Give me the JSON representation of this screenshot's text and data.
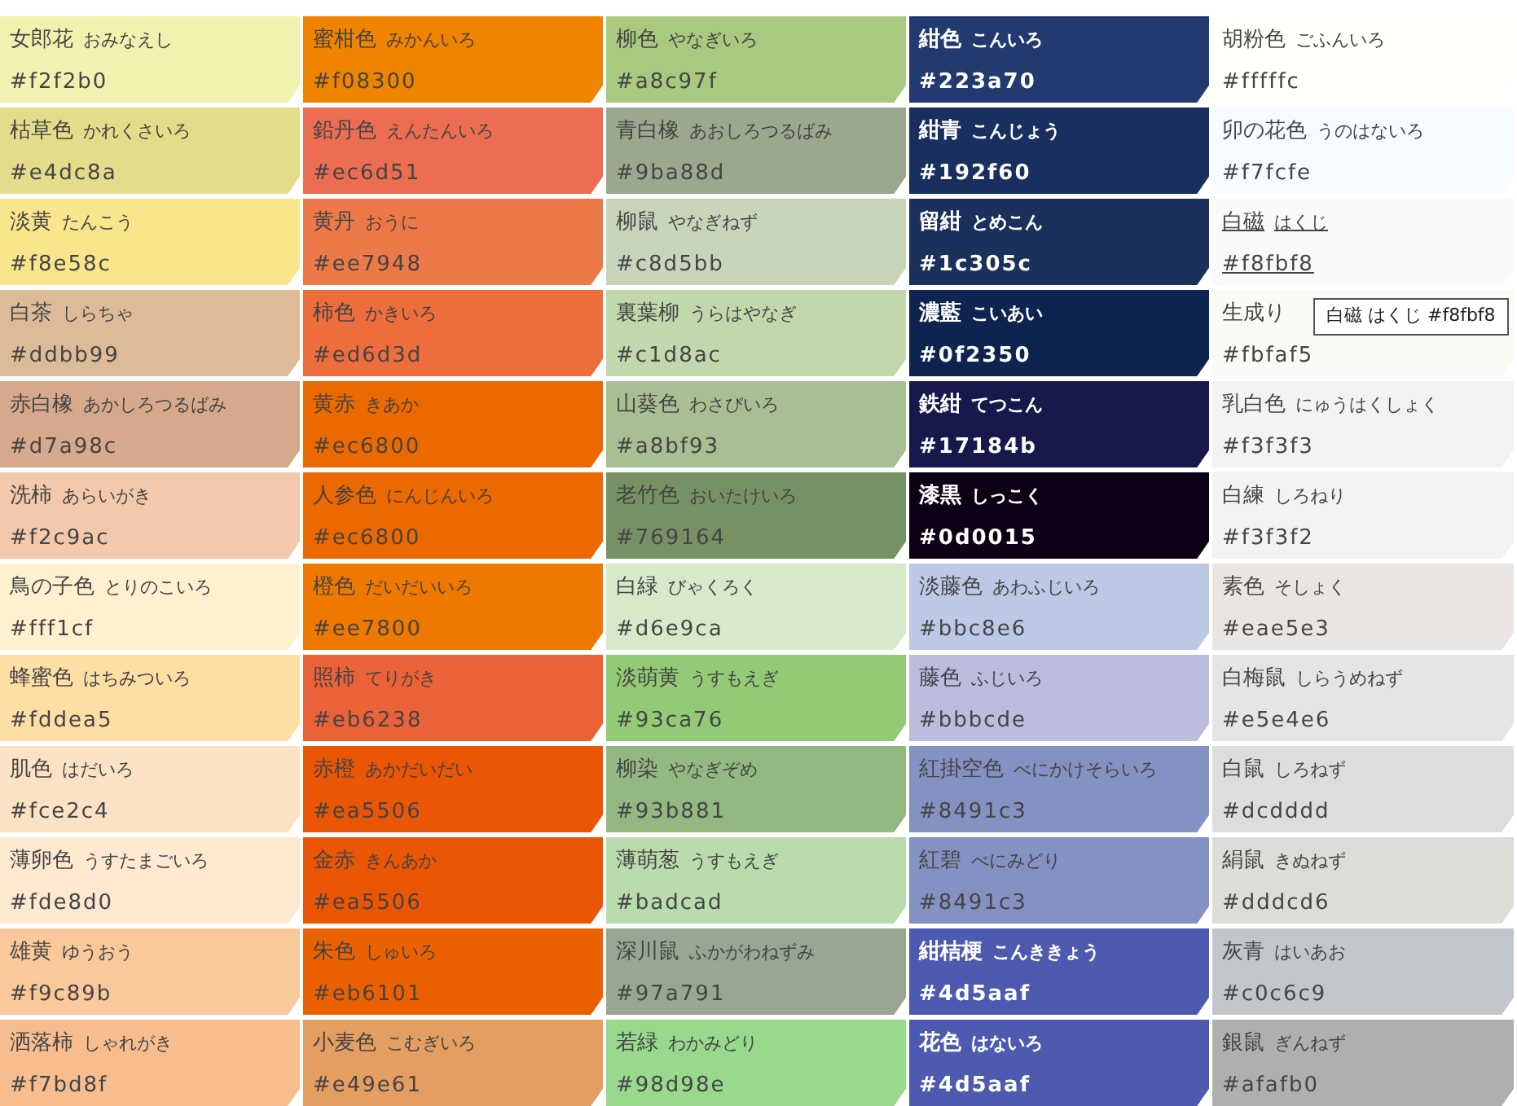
{
  "columns": [
    {
      "swatches": [
        {
          "name": "女郎花",
          "reading": "おみなえし",
          "hex": "#f2f2b0",
          "color": "#f2f2b0",
          "hovered": false
        },
        {
          "name": "枯草色",
          "reading": "かれくさいろ",
          "hex": "#e4dc8a",
          "color": "#e4dc8a",
          "hovered": false
        },
        {
          "name": "淡黄",
          "reading": "たんこう",
          "hex": "#f8e58c",
          "color": "#f8e58c",
          "hovered": false
        },
        {
          "name": "白茶",
          "reading": "しらちゃ",
          "hex": "#ddbb99",
          "color": "#ddbb99",
          "hovered": false
        },
        {
          "name": "赤白橡",
          "reading": "あかしろつるばみ",
          "hex": "#d7a98c",
          "color": "#d7a98c",
          "hovered": false
        },
        {
          "name": "洗柿",
          "reading": "あらいがき",
          "hex": "#f2c9ac",
          "color": "#f2c9ac",
          "hovered": false
        },
        {
          "name": "鳥の子色",
          "reading": "とりのこいろ",
          "hex": "#fff1cf",
          "color": "#fff1cf",
          "hovered": false
        },
        {
          "name": "蜂蜜色",
          "reading": "はちみついろ",
          "hex": "#fddea5",
          "color": "#fddea5",
          "hovered": false
        },
        {
          "name": "肌色",
          "reading": "はだいろ",
          "hex": "#fce2c4",
          "color": "#fce2c4",
          "hovered": false
        },
        {
          "name": "薄卵色",
          "reading": "うすたまごいろ",
          "hex": "#fde8d0",
          "color": "#fde8d0",
          "hovered": false
        },
        {
          "name": "雄黄",
          "reading": "ゆうおう",
          "hex": "#f9c89b",
          "color": "#f9c89b",
          "hovered": false
        },
        {
          "name": "洒落柿",
          "reading": "しゃれがき",
          "hex": "#f7bd8f",
          "color": "#f7bd8f",
          "hovered": false
        }
      ]
    },
    {
      "swatches": [
        {
          "name": "蜜柑色",
          "reading": "みかんいろ",
          "hex": "#f08300",
          "color": "#f08300",
          "hovered": false
        },
        {
          "name": "鉛丹色",
          "reading": "えんたんいろ",
          "hex": "#ec6d51",
          "color": "#ec6d51",
          "hovered": false
        },
        {
          "name": "黄丹",
          "reading": "おうに",
          "hex": "#ee7948",
          "color": "#ee7948",
          "hovered": false
        },
        {
          "name": "柿色",
          "reading": "かきいろ",
          "hex": "#ed6d3d",
          "color": "#ed6d3d",
          "hovered": false
        },
        {
          "name": "黄赤",
          "reading": "きあか",
          "hex": "#ec6800",
          "color": "#ec6800",
          "hovered": false
        },
        {
          "name": "人参色",
          "reading": "にんじんいろ",
          "hex": "#ec6800",
          "color": "#ec6800",
          "hovered": false
        },
        {
          "name": "橙色",
          "reading": "だいだいいろ",
          "hex": "#ee7800",
          "color": "#ee7800",
          "hovered": false
        },
        {
          "name": "照柿",
          "reading": "てりがき",
          "hex": "#eb6238",
          "color": "#eb6238",
          "hovered": false
        },
        {
          "name": "赤橙",
          "reading": "あかだいだい",
          "hex": "#ea5506",
          "color": "#ea5506",
          "hovered": false
        },
        {
          "name": "金赤",
          "reading": "きんあか",
          "hex": "#ea5506",
          "color": "#ea5506",
          "hovered": false
        },
        {
          "name": "朱色",
          "reading": "しゅいろ",
          "hex": "#eb6101",
          "color": "#eb6101",
          "hovered": false
        },
        {
          "name": "小麦色",
          "reading": "こむぎいろ",
          "hex": "#e49e61",
          "color": "#e49e61",
          "hovered": false
        }
      ]
    },
    {
      "swatches": [
        {
          "name": "柳色",
          "reading": "やなぎいろ",
          "hex": "#a8c97f",
          "color": "#a8c97f",
          "hovered": false
        },
        {
          "name": "青白橡",
          "reading": "あおしろつるばみ",
          "hex": "#9ba88d",
          "color": "#9ba88d",
          "hovered": false
        },
        {
          "name": "柳鼠",
          "reading": "やなぎねず",
          "hex": "#c8d5bb",
          "color": "#c8d5bb",
          "hovered": false
        },
        {
          "name": "裏葉柳",
          "reading": "うらはやなぎ",
          "hex": "#c1d8ac",
          "color": "#c1d8ac",
          "hovered": false
        },
        {
          "name": "山葵色",
          "reading": "わさびいろ",
          "hex": "#a8bf93",
          "color": "#a8bf93",
          "hovered": false
        },
        {
          "name": "老竹色",
          "reading": "おいたけいろ",
          "hex": "#769164",
          "color": "#769164",
          "hovered": false
        },
        {
          "name": "白緑",
          "reading": "びゃくろく",
          "hex": "#d6e9ca",
          "color": "#d6e9ca",
          "hovered": false
        },
        {
          "name": "淡萌黄",
          "reading": "うすもえぎ",
          "hex": "#93ca76",
          "color": "#93ca76",
          "hovered": false
        },
        {
          "name": "柳染",
          "reading": "やなぎぞめ",
          "hex": "#93b881",
          "color": "#93b881",
          "hovered": false
        },
        {
          "name": "薄萌葱",
          "reading": "うすもえぎ",
          "hex": "#badcad",
          "color": "#badcad",
          "hovered": false
        },
        {
          "name": "深川鼠",
          "reading": "ふかがわねずみ",
          "hex": "#97a791",
          "color": "#97a791",
          "hovered": false
        },
        {
          "name": "若緑",
          "reading": "わかみどり",
          "hex": "#98d98e",
          "color": "#98d98e",
          "hovered": false
        }
      ]
    },
    {
      "swatches": [
        {
          "name": "紺色",
          "reading": "こんいろ",
          "hex": "#223a70",
          "color": "#223a70",
          "hovered": false
        },
        {
          "name": "紺青",
          "reading": "こんじょう",
          "hex": "#192f60",
          "color": "#192f60",
          "hovered": false
        },
        {
          "name": "留紺",
          "reading": "とめこん",
          "hex": "#1c305c",
          "color": "#1c305c",
          "hovered": false
        },
        {
          "name": "濃藍",
          "reading": "こいあい",
          "hex": "#0f2350",
          "color": "#0f2350",
          "hovered": false
        },
        {
          "name": "鉄紺",
          "reading": "てつこん",
          "hex": "#17184b",
          "color": "#17184b",
          "hovered": false
        },
        {
          "name": "漆黒",
          "reading": "しっこく",
          "hex": "#0d0015",
          "color": "#0d0015",
          "hovered": false
        },
        {
          "name": "淡藤色",
          "reading": "あわふじいろ",
          "hex": "#bbc8e6",
          "color": "#bbc8e6",
          "hovered": false
        },
        {
          "name": "藤色",
          "reading": "ふじいろ",
          "hex": "#bbbcde",
          "color": "#bbbcde",
          "hovered": false
        },
        {
          "name": "紅掛空色",
          "reading": "べにかけそらいろ",
          "hex": "#8491c3",
          "color": "#8491c3",
          "hovered": false
        },
        {
          "name": "紅碧",
          "reading": "べにみどり",
          "hex": "#8491c3",
          "color": "#8491c3",
          "hovered": false
        },
        {
          "name": "紺桔梗",
          "reading": "こんききょう",
          "hex": "#4d5aaf",
          "color": "#4d5aaf",
          "hovered": false
        },
        {
          "name": "花色",
          "reading": "はないろ",
          "hex": "#4d5aaf",
          "color": "#4d5aaf",
          "hovered": false
        }
      ]
    },
    {
      "swatches": [
        {
          "name": "胡粉色",
          "reading": "ごふんいろ",
          "hex": "#fffffc",
          "color": "#fffffc",
          "hovered": false
        },
        {
          "name": "卯の花色",
          "reading": "うのはないろ",
          "hex": "#f7fcfe",
          "color": "#f7fcfe",
          "hovered": false
        },
        {
          "name": "白磁",
          "reading": "はくじ",
          "hex": "#f8fbf8",
          "color": "#f8fbf8",
          "hovered": true
        },
        {
          "name": "生成り",
          "hex": "#fbfaf5",
          "color": "#fbfaf5",
          "hovered": false,
          "tooltip": "白磁 はくじ #f8fbf8"
        },
        {
          "name": "乳白色",
          "reading": "にゅうはくしょく",
          "hex": "#f3f3f3",
          "color": "#f3f3f3",
          "hovered": false
        },
        {
          "name": "白練",
          "reading": "しろねり",
          "hex": "#f3f3f2",
          "color": "#f3f3f2",
          "hovered": false
        },
        {
          "name": "素色",
          "reading": "そしょく",
          "hex": "#eae5e3",
          "color": "#eae5e3",
          "hovered": false
        },
        {
          "name": "白梅鼠",
          "reading": "しらうめねず",
          "hex": "#e5e4e6",
          "color": "#e5e4e6",
          "hovered": false
        },
        {
          "name": "白鼠",
          "reading": "しろねず",
          "hex": "#dcdddd",
          "color": "#dcdddd",
          "hovered": false
        },
        {
          "name": "絹鼠",
          "reading": "きぬねず",
          "hex": "#dddcd6",
          "color": "#dddcd6",
          "hovered": false
        },
        {
          "name": "灰青",
          "reading": "はいあお",
          "hex": "#c0c6c9",
          "color": "#c0c6c9",
          "hovered": false
        },
        {
          "name": "銀鼠",
          "reading": "ぎんねず",
          "hex": "#afafb0",
          "color": "#afafb0",
          "hovered": false
        }
      ]
    }
  ]
}
